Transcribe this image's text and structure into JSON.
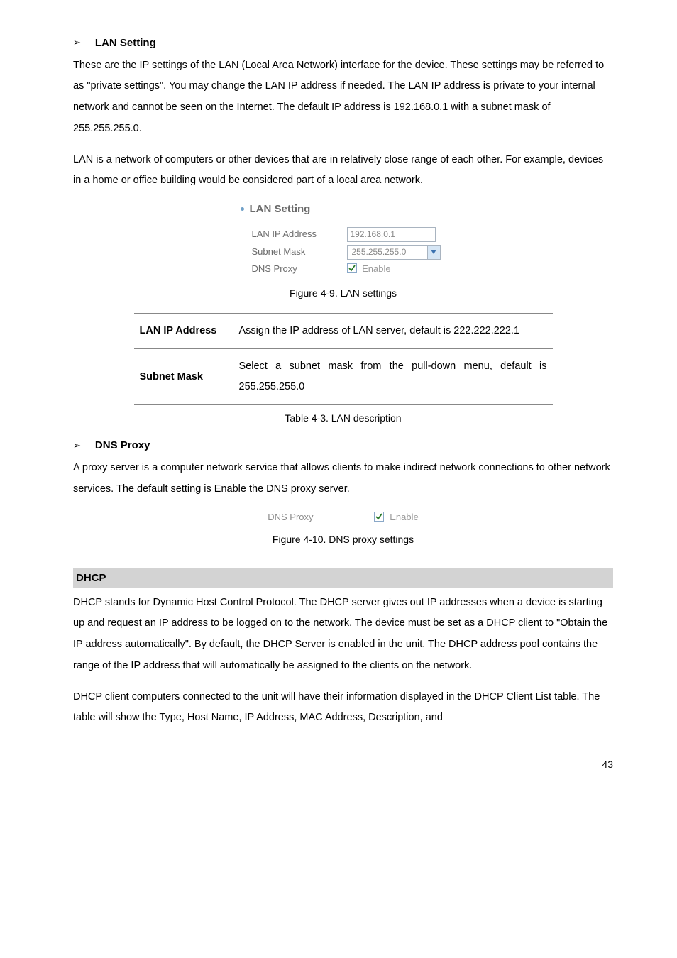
{
  "sections": {
    "lan": {
      "title": "LAN Setting",
      "para1": "These are the IP settings of the LAN (Local Area Network) interface for the device. These settings may be referred to as \"private settings\". You may change the LAN IP address if needed. The LAN IP address is private to your internal network and cannot be seen on the Internet. The default IP address is 192.168.0.1 with a subnet mask of 255.255.255.0.",
      "para2": "LAN is a network of computers or other devices that are in relatively close range of each other. For example, devices in a home or office building would be considered part of a local area network."
    },
    "dns": {
      "title": "DNS Proxy",
      "para": "A proxy server is a computer network service that allows clients to make indirect network connections to other network services. The default setting is Enable the DNS proxy server."
    },
    "dhcp": {
      "title": "DHCP",
      "para1": "DHCP stands for Dynamic Host Control Protocol. The DHCP server gives out IP addresses when a device is starting up and request an IP address to be logged on to the network. The device must be set as a DHCP client to \"Obtain the IP address automatically\". By default, the DHCP Server is enabled in the unit. The DHCP address pool contains the range of the IP address that will automatically be assigned to the clients on the network.",
      "para2": "DHCP client computers connected to the unit will have their information displayed in the DHCP Client List table. The table will show the Type, Host Name, IP Address, MAC Address, Description, and"
    }
  },
  "lan_widget": {
    "heading": "LAN Setting",
    "rows": {
      "ip_label": "LAN IP Address",
      "ip_value": "192.168.0.1",
      "mask_label": "Subnet Mask",
      "mask_value": "255.255.255.0",
      "dns_label": "DNS Proxy",
      "enable_label": "Enable"
    }
  },
  "captions": {
    "fig_lan": "Figure 4-9. LAN settings",
    "tbl_lan": "Table 4-3. LAN description",
    "fig_dns": "Figure 4-10. DNS proxy settings"
  },
  "desc_table": {
    "row1_label": "LAN IP Address",
    "row1_text": "Assign the IP address of LAN server, default is 222.222.222.1",
    "row2_label": "Subnet Mask",
    "row2_text": "Select a subnet mask from the pull-down menu, default is 255.255.255.0"
  },
  "dns_widget": {
    "label": "DNS Proxy",
    "enable_label": "Enable"
  },
  "page_number": "43"
}
